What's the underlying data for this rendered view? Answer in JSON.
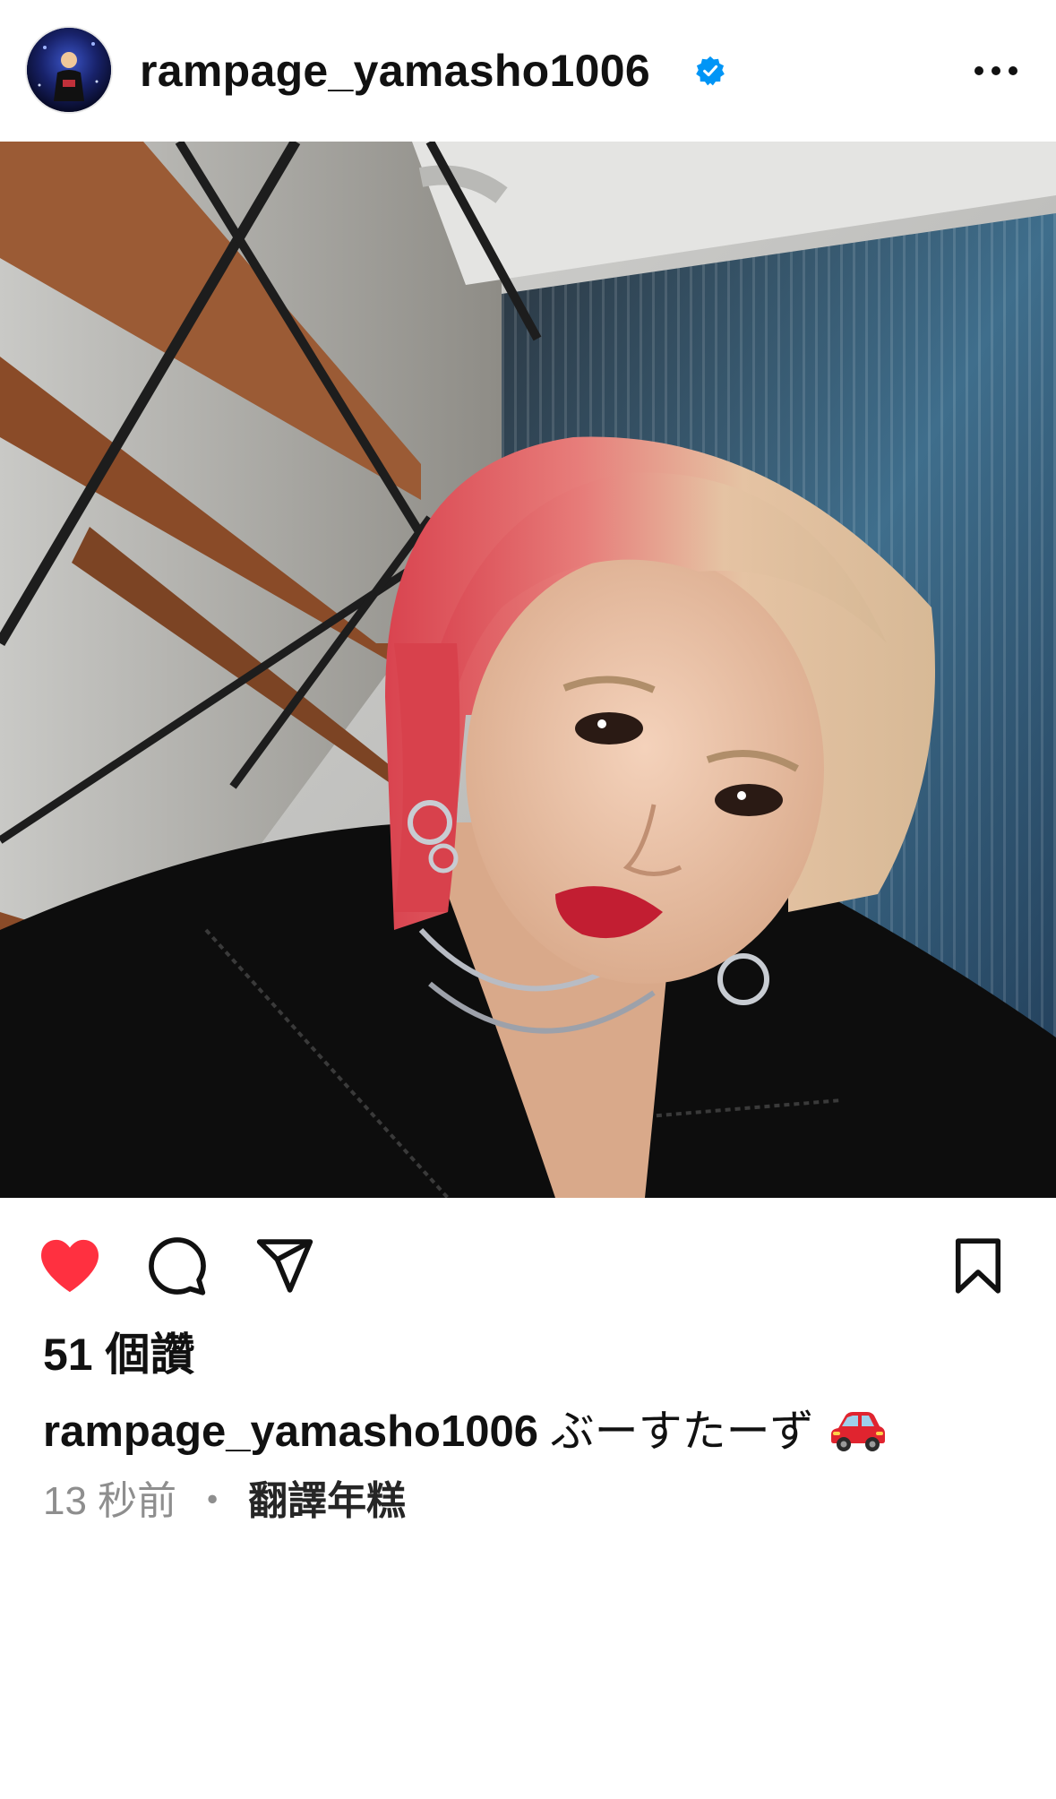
{
  "post": {
    "username": "rampage_yamasho1006",
    "verified_icon": "verified-badge-icon",
    "more_icon": "more-options-icon",
    "photo_alt": "post-photo",
    "actions": {
      "like_icon": "heart-filled-icon",
      "comment_icon": "comment-icon",
      "share_icon": "share-paper-plane-icon",
      "save_icon": "bookmark-icon"
    },
    "likes_text": "51 個讚",
    "caption": {
      "username": "rampage_yamasho1006",
      "text": "ぶーすたーず",
      "emoji_icon": "red-car-icon"
    },
    "timestamp": "13 秒前",
    "separator": "・",
    "translate_label": "翻譯年糕"
  },
  "colors": {
    "like_red": "#ff3040",
    "verified_blue": "#0095f6",
    "text_primary": "#111111",
    "text_secondary": "#8e8e8e"
  }
}
